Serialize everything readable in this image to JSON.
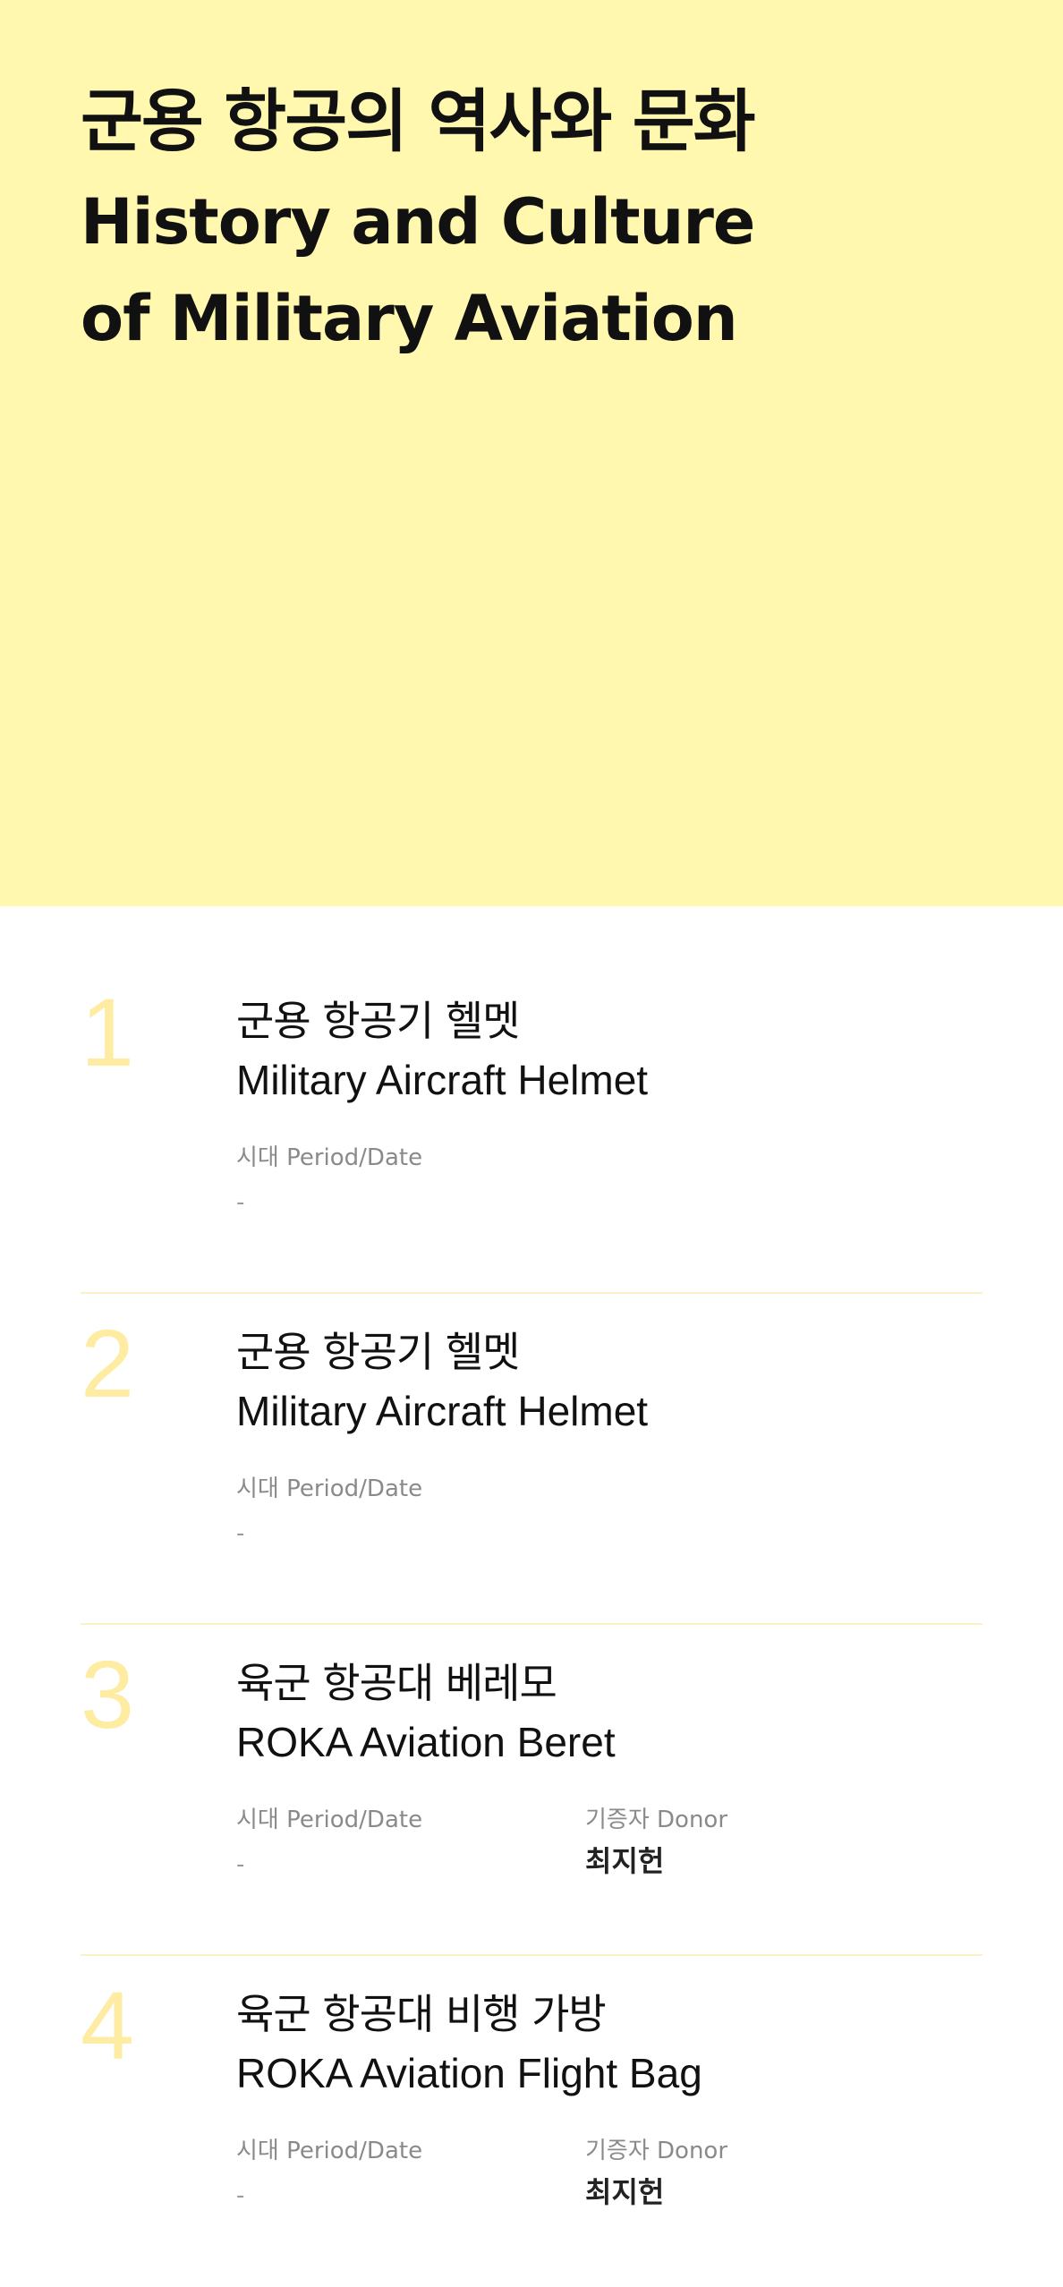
{
  "hero": {
    "title_ko": "군용 항공의 역사와 문화",
    "title_en": "History and Culture of Military Aviation",
    "background": "#fff8ae"
  },
  "items": [
    {
      "number": "1",
      "title_ko": "군용 항공기 헬멧",
      "title_en": "Military Aircraft Helmet",
      "period_label": "시대 Period/Date",
      "period_value": "-"
    },
    {
      "number": "2",
      "title_ko": "군용 항공기 헬멧",
      "title_en": "Military Aircraft Helmet",
      "period_label": "시대 Period/Date",
      "period_value": "-"
    },
    {
      "number": "3",
      "title_ko": "육군 항공대 베레모",
      "title_en": "ROKA Aviation Beret",
      "period_label": "시대 Period/Date",
      "period_value": "-",
      "donor_label": "기증자 Donor",
      "donor_value": "최지헌"
    },
    {
      "number": "4",
      "title_ko": "육군 항공대 비행 가방",
      "title_en": "ROKA Aviation Flight Bag",
      "period_label": "시대 Period/Date",
      "period_value": "-",
      "donor_label": "기증자 Donor",
      "donor_value": "최지헌"
    }
  ],
  "colors": {
    "number": "#fdeca2",
    "divider": "#fbf0c6"
  }
}
